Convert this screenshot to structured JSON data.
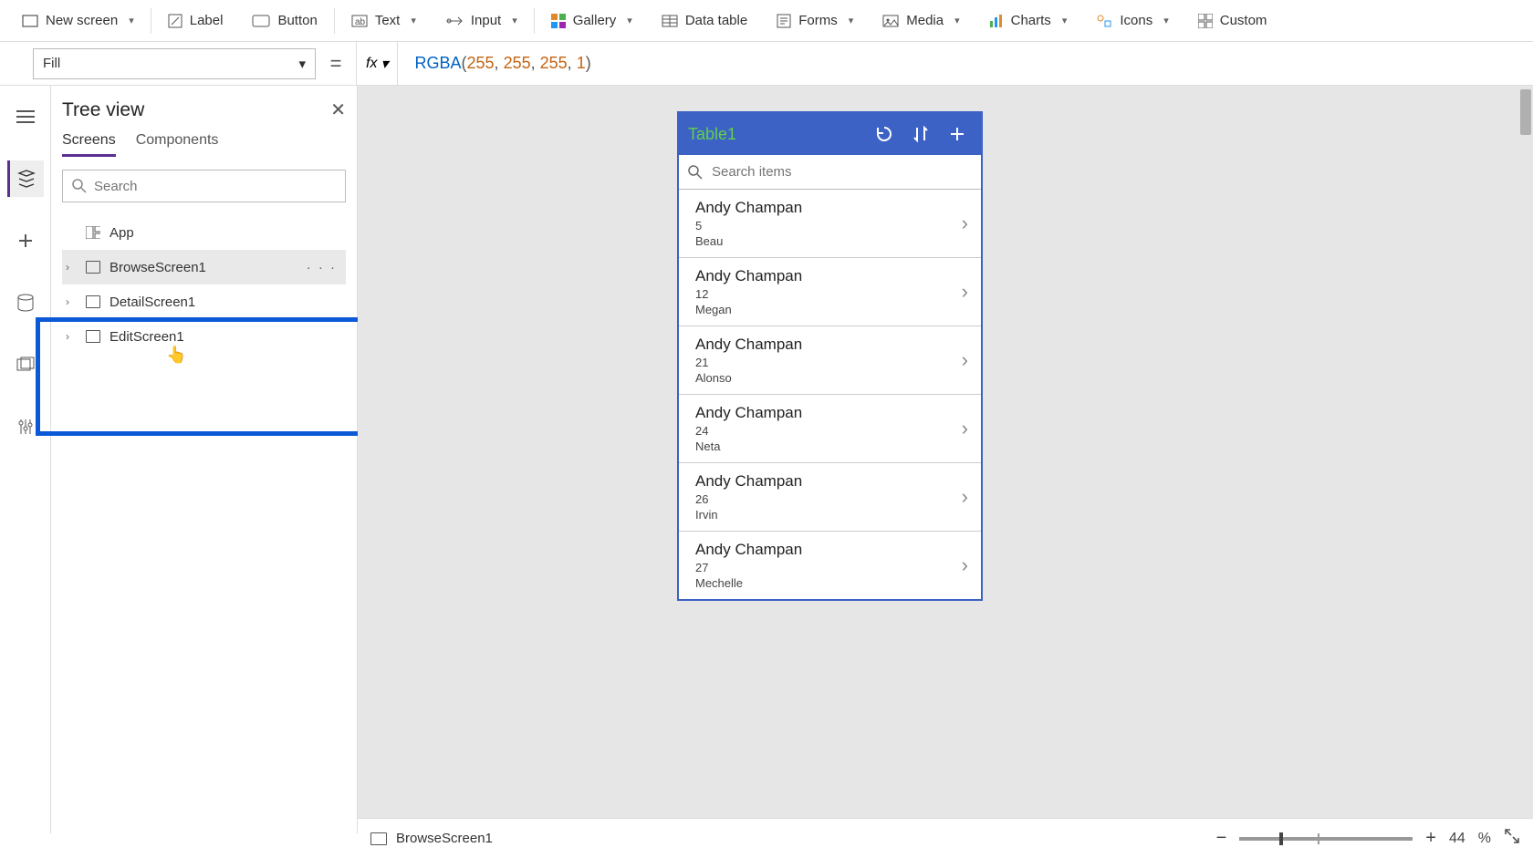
{
  "ribbon": {
    "new_screen": "New screen",
    "label": "Label",
    "button": "Button",
    "text": "Text",
    "input": "Input",
    "gallery": "Gallery",
    "data_table": "Data table",
    "forms": "Forms",
    "media": "Media",
    "charts": "Charts",
    "icons": "Icons",
    "custom": "Custom"
  },
  "propbar": {
    "property": "Fill",
    "fx": "fx",
    "func": "RGBA",
    "args": [
      "255",
      "255",
      "255",
      "1"
    ]
  },
  "tree": {
    "title": "Tree view",
    "tabs": {
      "screens": "Screens",
      "components": "Components"
    },
    "search_placeholder": "Search",
    "app": "App",
    "items": [
      {
        "label": "BrowseScreen1",
        "selected": true
      },
      {
        "label": "DetailScreen1",
        "selected": false
      },
      {
        "label": "EditScreen1",
        "selected": false
      }
    ]
  },
  "phone": {
    "title": "Table1",
    "search_placeholder": "Search items",
    "rows": [
      {
        "title": "Andy Champan",
        "sub1": "5",
        "sub2": "Beau"
      },
      {
        "title": "Andy Champan",
        "sub1": "12",
        "sub2": "Megan"
      },
      {
        "title": "Andy Champan",
        "sub1": "21",
        "sub2": "Alonso"
      },
      {
        "title": "Andy Champan",
        "sub1": "24",
        "sub2": "Neta"
      },
      {
        "title": "Andy Champan",
        "sub1": "26",
        "sub2": "Irvin"
      },
      {
        "title": "Andy Champan",
        "sub1": "27",
        "sub2": "Mechelle"
      }
    ]
  },
  "status": {
    "screen": "BrowseScreen1",
    "zoom": "44",
    "pct": "%"
  }
}
